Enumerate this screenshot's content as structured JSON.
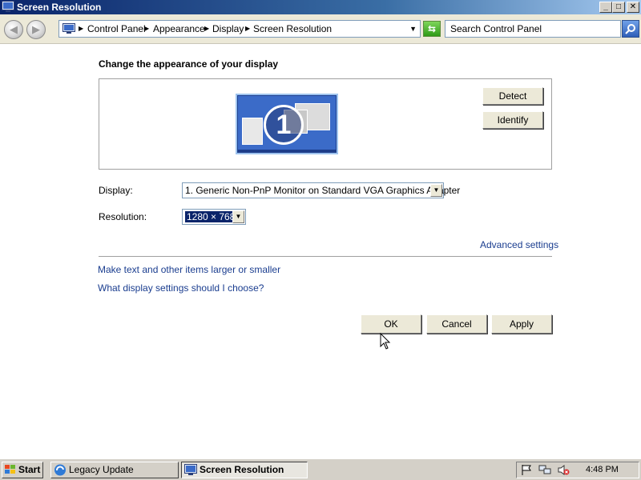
{
  "window": {
    "title": "Screen Resolution",
    "controls": {
      "minimize": "_",
      "maximize": "□",
      "close": "✕"
    }
  },
  "address_bar": {
    "breadcrumbs": [
      "Control Panel",
      "Appearance",
      "Display",
      "Screen Resolution"
    ],
    "search_placeholder": "Search Control Panel"
  },
  "main": {
    "heading": "Change the appearance of your display",
    "monitor_number": "1",
    "detect_label": "Detect",
    "identify_label": "Identify",
    "display_label": "Display:",
    "display_value": "1. Generic Non-PnP Monitor on Standard VGA Graphics Adapter",
    "resolution_label": "Resolution:",
    "resolution_value": "1280 × 768",
    "advanced_link": "Advanced settings",
    "link_text_size": "Make text and other items larger or smaller",
    "link_display_help": "What display settings should I choose?",
    "ok_label": "OK",
    "cancel_label": "Cancel",
    "apply_label": "Apply"
  },
  "taskbar": {
    "start_label": "Start",
    "tasks": [
      "Legacy Update",
      "Screen Resolution"
    ],
    "clock": "4:48 PM"
  },
  "colors": {
    "titlebar": "#0a246a",
    "link": "#1a3d8f",
    "monitor": "#3b6bc8",
    "face": "#ece9d8"
  }
}
